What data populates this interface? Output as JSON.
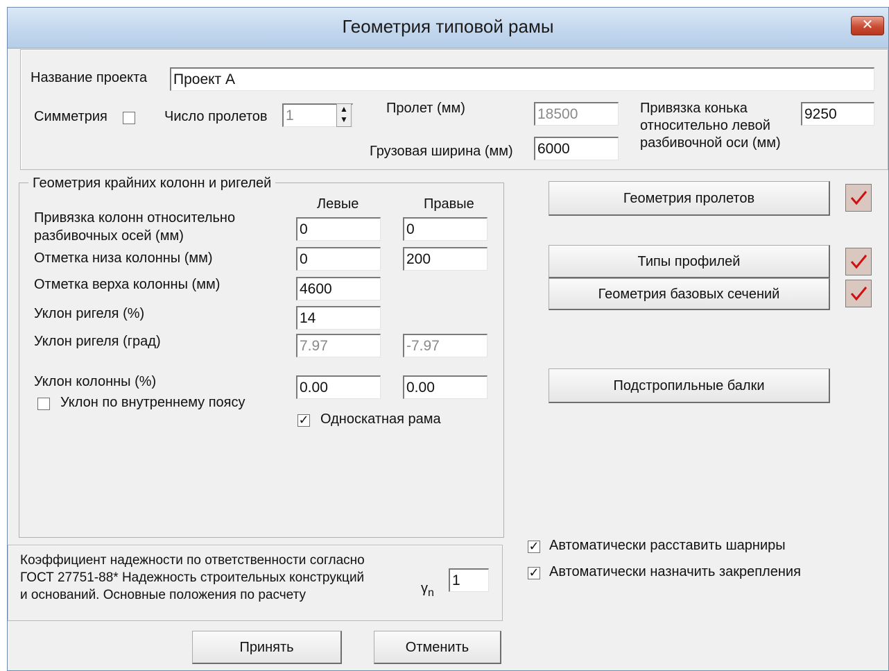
{
  "window": {
    "title": "Геометрия типовой рамы",
    "close_symbol": "✕"
  },
  "project": {
    "name_label": "Название проекта",
    "name_value": "Проект А",
    "symmetry_label": "Симметрия",
    "spans_count_label": "Число пролетов",
    "spans_count_value": "1",
    "span_label": "Пролет (мм)",
    "span_value": "18500",
    "load_width_label": "Грузовая ширина (мм)",
    "load_width_value": "6000",
    "ridge_label_line1": "Привязка конька",
    "ridge_label_line2": "относительно левой",
    "ridge_label_line3": "разбивочной оси (мм)",
    "ridge_value": "9250"
  },
  "columns": {
    "group_title": "Геометрия крайних колонн и ригелей",
    "left_header": "Левые",
    "right_header": "Правые",
    "binding_label_line1": "Привязка колонн относительно",
    "binding_label_line2": "разбивочных осей (мм)",
    "binding_left": "0",
    "binding_right": "0",
    "bottom_label": "Отметка низа колонны (мм)",
    "bottom_left": "0",
    "bottom_right": "200",
    "top_label": "Отметка верха колонны (мм)",
    "top_left": "4600",
    "rafter_pct_label": "Уклон ригеля  (%)",
    "rafter_pct_left": "14",
    "rafter_deg_label": "Уклон ригеля (град)",
    "rafter_deg_left": "7.97",
    "rafter_deg_right": "-7.97",
    "col_slope_label": "Уклон колонны  (%)",
    "col_slope_left": "0.00",
    "col_slope_right": "0.00",
    "inner_belt_label": "Уклон по внутреннему поясу",
    "single_slope_label": "Односкатная рама"
  },
  "reliability": {
    "line1": "Коэффициент надежности по ответственности согласно",
    "line2": "ГОСТ 27751-88* Надежность строительных конструкций",
    "line3": "и оснований. Основные положения по расчету",
    "gamma_symbol": "γ",
    "gamma_sub": "n",
    "value": "1"
  },
  "buttons": {
    "span_geometry": "Геометрия пролетов",
    "profile_types": "Типы профилей",
    "base_sections": "Геометрия базовых сечений",
    "sub_rafter_beams": "Подстропильные балки",
    "accept": "Принять",
    "cancel": "Отменить"
  },
  "options": {
    "auto_hinges": "Автоматически расставить шарниры",
    "auto_supports": "Автоматически назначить закрепления"
  },
  "check_mark": "✓",
  "colors": {
    "title_bar": "#c3d7ee",
    "close_red": "#c94c33",
    "check_red": "#d01010",
    "status_box": "#d9c7c0"
  }
}
